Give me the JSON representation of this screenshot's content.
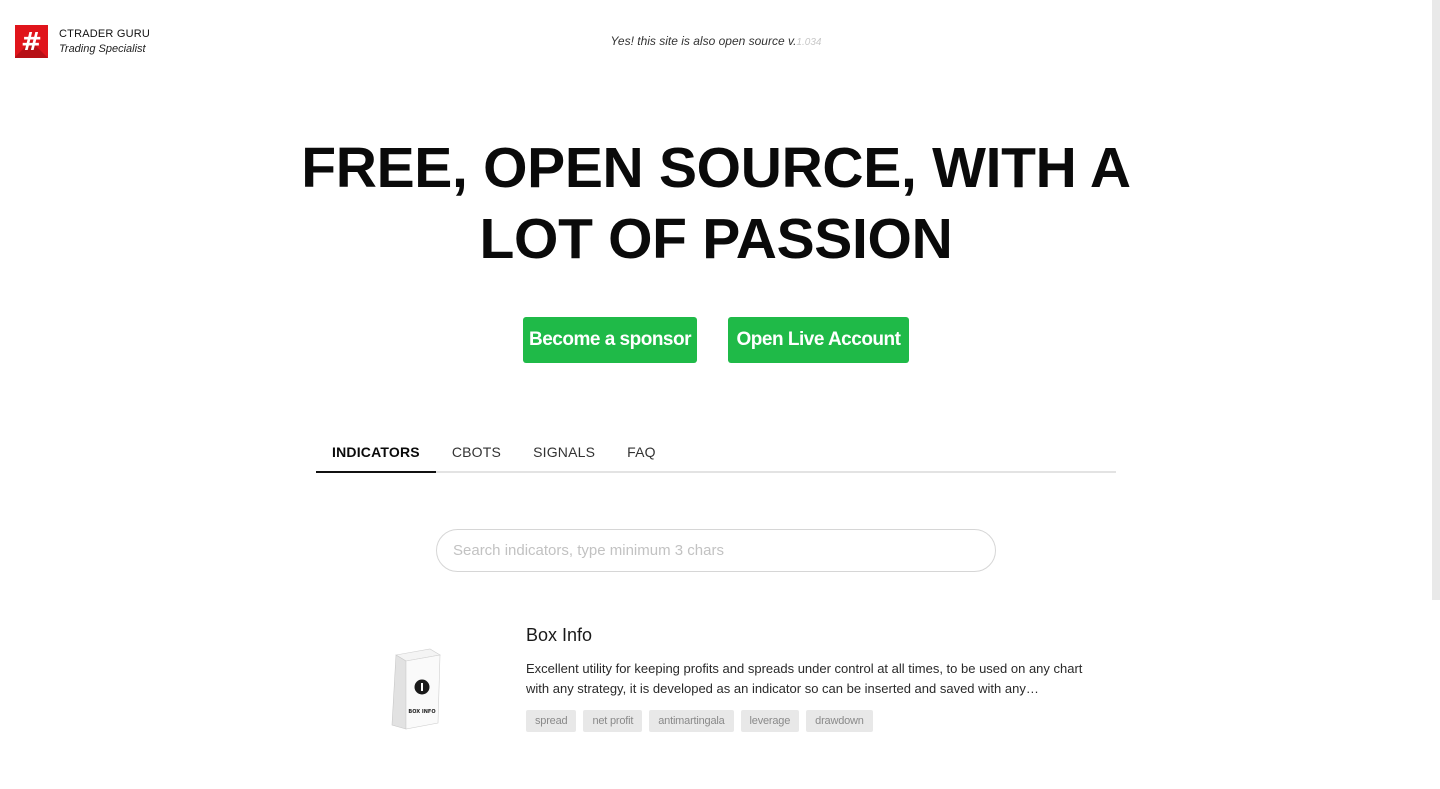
{
  "brand": {
    "logo_char": "#",
    "name": "CTRADER GURU",
    "tagline": "Trading Specialist"
  },
  "header_note": {
    "text": "Yes! this site is also open source v.",
    "version": "1.034"
  },
  "hero": {
    "title_line1": "FREE, OPEN SOURCE, WITH A",
    "title_line2": "LOT OF PASSION"
  },
  "buttons": {
    "sponsor": "Become a sponsor",
    "live_account": "Open Live Account"
  },
  "tabs": [
    {
      "label": "INDICATORS",
      "active": true
    },
    {
      "label": "CBOTS",
      "active": false
    },
    {
      "label": "SIGNALS",
      "active": false
    },
    {
      "label": "FAQ",
      "active": false
    }
  ],
  "search": {
    "placeholder": "Search indicators, type minimum 3 chars",
    "value": ""
  },
  "products": [
    {
      "title": "Box Info",
      "description": "Excellent utility for keeping profits and spreads under control at all times, to be used on any chart with any strategy, it is developed as an indicator so can be inserted and saved with any…",
      "box_label": "BOX INFO",
      "tags": [
        "spread",
        "net profit",
        "antimartingala",
        "leverage",
        "drawdown"
      ]
    }
  ],
  "colors": {
    "accent_green": "#1fba48",
    "logo_red": "#e0141b",
    "tag_bg": "#e8e8e8"
  }
}
